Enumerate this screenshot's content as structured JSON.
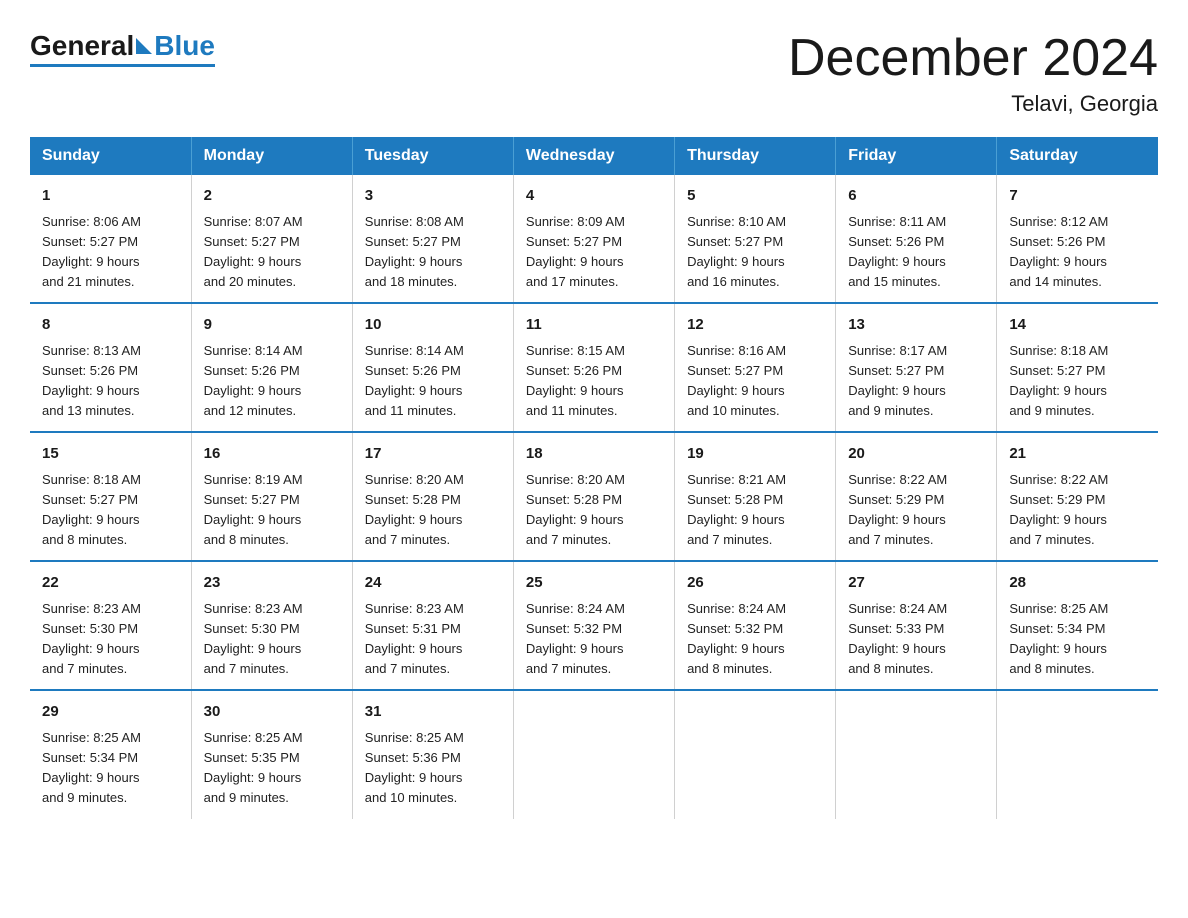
{
  "logo": {
    "general": "General",
    "blue": "Blue"
  },
  "title": "December 2024",
  "subtitle": "Telavi, Georgia",
  "days_of_week": [
    "Sunday",
    "Monday",
    "Tuesday",
    "Wednesday",
    "Thursday",
    "Friday",
    "Saturday"
  ],
  "weeks": [
    [
      {
        "day": "1",
        "info": "Sunrise: 8:06 AM\nSunset: 5:27 PM\nDaylight: 9 hours\nand 21 minutes."
      },
      {
        "day": "2",
        "info": "Sunrise: 8:07 AM\nSunset: 5:27 PM\nDaylight: 9 hours\nand 20 minutes."
      },
      {
        "day": "3",
        "info": "Sunrise: 8:08 AM\nSunset: 5:27 PM\nDaylight: 9 hours\nand 18 minutes."
      },
      {
        "day": "4",
        "info": "Sunrise: 8:09 AM\nSunset: 5:27 PM\nDaylight: 9 hours\nand 17 minutes."
      },
      {
        "day": "5",
        "info": "Sunrise: 8:10 AM\nSunset: 5:27 PM\nDaylight: 9 hours\nand 16 minutes."
      },
      {
        "day": "6",
        "info": "Sunrise: 8:11 AM\nSunset: 5:26 PM\nDaylight: 9 hours\nand 15 minutes."
      },
      {
        "day": "7",
        "info": "Sunrise: 8:12 AM\nSunset: 5:26 PM\nDaylight: 9 hours\nand 14 minutes."
      }
    ],
    [
      {
        "day": "8",
        "info": "Sunrise: 8:13 AM\nSunset: 5:26 PM\nDaylight: 9 hours\nand 13 minutes."
      },
      {
        "day": "9",
        "info": "Sunrise: 8:14 AM\nSunset: 5:26 PM\nDaylight: 9 hours\nand 12 minutes."
      },
      {
        "day": "10",
        "info": "Sunrise: 8:14 AM\nSunset: 5:26 PM\nDaylight: 9 hours\nand 11 minutes."
      },
      {
        "day": "11",
        "info": "Sunrise: 8:15 AM\nSunset: 5:26 PM\nDaylight: 9 hours\nand 11 minutes."
      },
      {
        "day": "12",
        "info": "Sunrise: 8:16 AM\nSunset: 5:27 PM\nDaylight: 9 hours\nand 10 minutes."
      },
      {
        "day": "13",
        "info": "Sunrise: 8:17 AM\nSunset: 5:27 PM\nDaylight: 9 hours\nand 9 minutes."
      },
      {
        "day": "14",
        "info": "Sunrise: 8:18 AM\nSunset: 5:27 PM\nDaylight: 9 hours\nand 9 minutes."
      }
    ],
    [
      {
        "day": "15",
        "info": "Sunrise: 8:18 AM\nSunset: 5:27 PM\nDaylight: 9 hours\nand 8 minutes."
      },
      {
        "day": "16",
        "info": "Sunrise: 8:19 AM\nSunset: 5:27 PM\nDaylight: 9 hours\nand 8 minutes."
      },
      {
        "day": "17",
        "info": "Sunrise: 8:20 AM\nSunset: 5:28 PM\nDaylight: 9 hours\nand 7 minutes."
      },
      {
        "day": "18",
        "info": "Sunrise: 8:20 AM\nSunset: 5:28 PM\nDaylight: 9 hours\nand 7 minutes."
      },
      {
        "day": "19",
        "info": "Sunrise: 8:21 AM\nSunset: 5:28 PM\nDaylight: 9 hours\nand 7 minutes."
      },
      {
        "day": "20",
        "info": "Sunrise: 8:22 AM\nSunset: 5:29 PM\nDaylight: 9 hours\nand 7 minutes."
      },
      {
        "day": "21",
        "info": "Sunrise: 8:22 AM\nSunset: 5:29 PM\nDaylight: 9 hours\nand 7 minutes."
      }
    ],
    [
      {
        "day": "22",
        "info": "Sunrise: 8:23 AM\nSunset: 5:30 PM\nDaylight: 9 hours\nand 7 minutes."
      },
      {
        "day": "23",
        "info": "Sunrise: 8:23 AM\nSunset: 5:30 PM\nDaylight: 9 hours\nand 7 minutes."
      },
      {
        "day": "24",
        "info": "Sunrise: 8:23 AM\nSunset: 5:31 PM\nDaylight: 9 hours\nand 7 minutes."
      },
      {
        "day": "25",
        "info": "Sunrise: 8:24 AM\nSunset: 5:32 PM\nDaylight: 9 hours\nand 7 minutes."
      },
      {
        "day": "26",
        "info": "Sunrise: 8:24 AM\nSunset: 5:32 PM\nDaylight: 9 hours\nand 8 minutes."
      },
      {
        "day": "27",
        "info": "Sunrise: 8:24 AM\nSunset: 5:33 PM\nDaylight: 9 hours\nand 8 minutes."
      },
      {
        "day": "28",
        "info": "Sunrise: 8:25 AM\nSunset: 5:34 PM\nDaylight: 9 hours\nand 8 minutes."
      }
    ],
    [
      {
        "day": "29",
        "info": "Sunrise: 8:25 AM\nSunset: 5:34 PM\nDaylight: 9 hours\nand 9 minutes."
      },
      {
        "day": "30",
        "info": "Sunrise: 8:25 AM\nSunset: 5:35 PM\nDaylight: 9 hours\nand 9 minutes."
      },
      {
        "day": "31",
        "info": "Sunrise: 8:25 AM\nSunset: 5:36 PM\nDaylight: 9 hours\nand 10 minutes."
      },
      {
        "day": "",
        "info": ""
      },
      {
        "day": "",
        "info": ""
      },
      {
        "day": "",
        "info": ""
      },
      {
        "day": "",
        "info": ""
      }
    ]
  ]
}
